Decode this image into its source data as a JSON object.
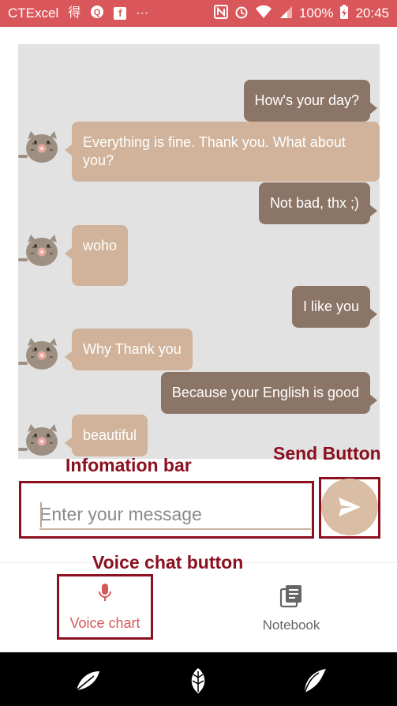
{
  "status_bar": {
    "carrier": "CTExcel",
    "char_icon": "得",
    "more": "···",
    "battery": "100%",
    "time": "20:45"
  },
  "chat": {
    "messages": [
      {
        "sender": "me",
        "text": "How's your day?"
      },
      {
        "sender": "bot",
        "text": "Everything is fine. Thank you. What about you?"
      },
      {
        "sender": "me",
        "text": "Not bad, thx ;)"
      },
      {
        "sender": "bot",
        "text": "woho"
      },
      {
        "sender": "me",
        "text": "I like you"
      },
      {
        "sender": "bot",
        "text": "Why Thank you"
      },
      {
        "sender": "me",
        "text": "Because your English is good"
      },
      {
        "sender": "bot",
        "text": "beautiful"
      }
    ]
  },
  "annotations": {
    "info_bar": "Infomation bar",
    "send_button": "Send Button",
    "voice_chat_button": "Voice chat button"
  },
  "input": {
    "placeholder": "Enter your message",
    "value": ""
  },
  "bottom_nav": {
    "voice_label": "Voice chart",
    "notebook_label": "Notebook"
  },
  "colors": {
    "status_bar": "#d9565a",
    "my_bubble": "#8b7566",
    "bot_bubble": "#d0b39a",
    "annotation": "#8b1020",
    "accent": "#d55a5a"
  }
}
